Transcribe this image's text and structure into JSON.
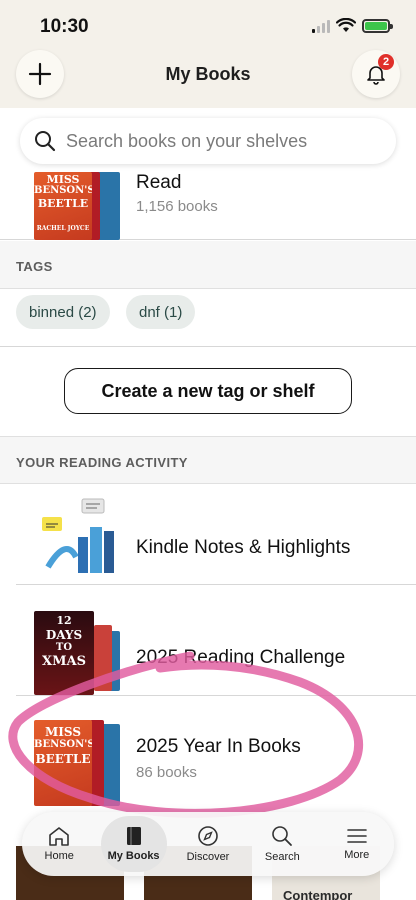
{
  "status_bar": {
    "time": "10:30"
  },
  "header": {
    "title": "My Books",
    "notifications_count": "2"
  },
  "search": {
    "placeholder": "Search books on your shelves"
  },
  "shelf": {
    "title": "Read",
    "count": "1,156 books"
  },
  "tags": {
    "heading": "TAGS",
    "items": [
      {
        "label": "binned (2)"
      },
      {
        "label": "dnf (1)"
      }
    ],
    "create_label": "Create a new tag or shelf"
  },
  "activity": {
    "heading": "YOUR READING ACTIVITY",
    "items": [
      {
        "title": "Kindle Notes & Highlights"
      },
      {
        "title": "2025 Reading Challenge"
      },
      {
        "title": "2025 Year In Books",
        "subtitle": "86 books"
      }
    ]
  },
  "covers": {
    "miss_line1": "MISS",
    "miss_line2": "BENSON'S",
    "miss_line3": "BEETLE",
    "miss_author": "RACHEL JOYCE",
    "xmas_line1": "12",
    "xmas_line2": "DAYS",
    "xmas_line3": "TO",
    "xmas_line4": "XMAS"
  },
  "peek": {
    "card_text": "Contempor"
  },
  "nav": {
    "tabs": [
      {
        "label": "Home",
        "icon": "home-icon"
      },
      {
        "label": "My Books",
        "icon": "book-icon"
      },
      {
        "label": "Discover",
        "icon": "compass-icon"
      },
      {
        "label": "Search",
        "icon": "search-icon"
      },
      {
        "label": "More",
        "icon": "menu-icon"
      }
    ]
  },
  "colors": {
    "header_bg": "#f4f1ea",
    "chip_bg": "#e8ecea",
    "badge": "#e0302a",
    "annotation": "#e05b9f"
  }
}
